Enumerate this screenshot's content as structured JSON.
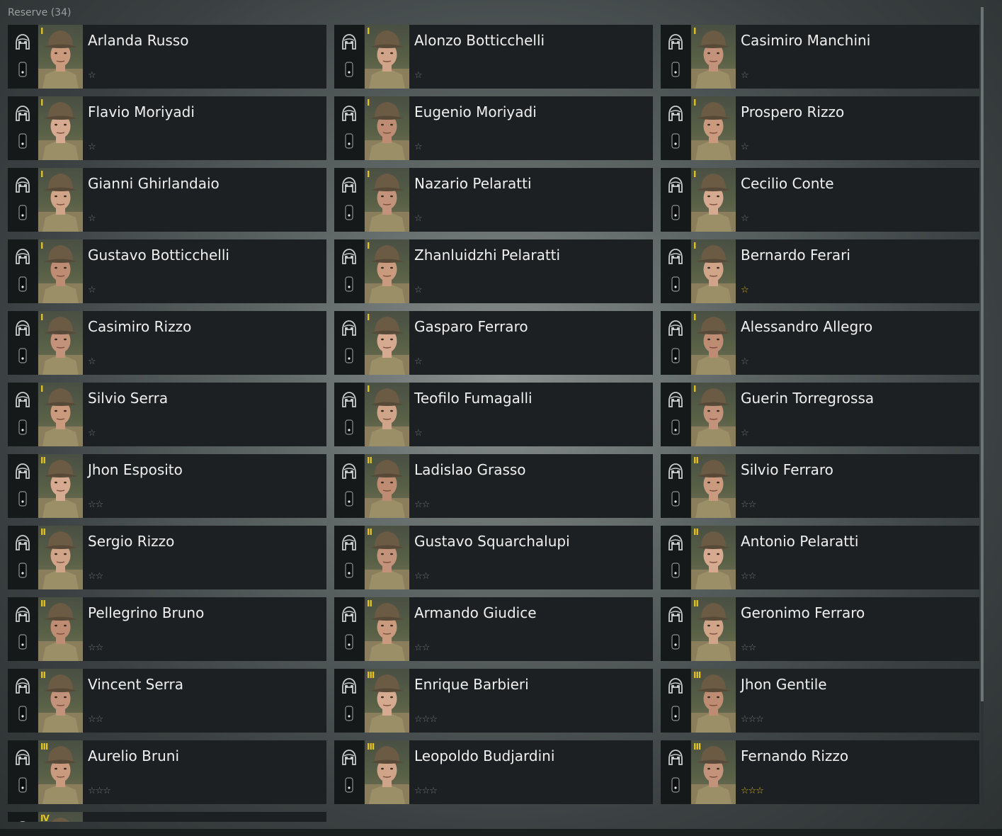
{
  "panel": {
    "title": "Reserve (34)"
  },
  "soldiers": [
    {
      "name": "Arlanda Russo",
      "tier": "I",
      "stars": 1,
      "gold": false
    },
    {
      "name": "Alonzo Botticchelli",
      "tier": "I",
      "stars": 1,
      "gold": false
    },
    {
      "name": "Casimiro Manchini",
      "tier": "I",
      "stars": 1,
      "gold": false
    },
    {
      "name": "Flavio Moriyadi",
      "tier": "I",
      "stars": 1,
      "gold": false
    },
    {
      "name": "Eugenio Moriyadi",
      "tier": "I",
      "stars": 1,
      "gold": false
    },
    {
      "name": "Prospero Rizzo",
      "tier": "I",
      "stars": 1,
      "gold": false
    },
    {
      "name": "Gianni Ghirlandaio",
      "tier": "I",
      "stars": 1,
      "gold": false
    },
    {
      "name": "Nazario Pelaratti",
      "tier": "I",
      "stars": 1,
      "gold": false
    },
    {
      "name": "Cecilio Conte",
      "tier": "I",
      "stars": 1,
      "gold": false
    },
    {
      "name": "Gustavo Botticchelli",
      "tier": "I",
      "stars": 1,
      "gold": false
    },
    {
      "name": "Zhanluidzhi Pelaratti",
      "tier": "I",
      "stars": 1,
      "gold": false
    },
    {
      "name": "Bernardo Ferari",
      "tier": "I",
      "stars": 1,
      "gold": true
    },
    {
      "name": "Casimiro Rizzo",
      "tier": "I",
      "stars": 1,
      "gold": false
    },
    {
      "name": "Gasparo Ferraro",
      "tier": "I",
      "stars": 1,
      "gold": false
    },
    {
      "name": "Alessandro Allegro",
      "tier": "I",
      "stars": 1,
      "gold": false
    },
    {
      "name": "Silvio Serra",
      "tier": "I",
      "stars": 1,
      "gold": false
    },
    {
      "name": "Teofilo Fumagalli",
      "tier": "I",
      "stars": 1,
      "gold": false
    },
    {
      "name": "Guerin Torregrossa",
      "tier": "I",
      "stars": 1,
      "gold": false
    },
    {
      "name": "Jhon Esposito",
      "tier": "II",
      "stars": 2,
      "gold": false
    },
    {
      "name": "Ladislao Grasso",
      "tier": "II",
      "stars": 2,
      "gold": false
    },
    {
      "name": "Silvio Ferraro",
      "tier": "II",
      "stars": 2,
      "gold": false
    },
    {
      "name": "Sergio Rizzo",
      "tier": "II",
      "stars": 2,
      "gold": false
    },
    {
      "name": "Gustavo Squarchalupi",
      "tier": "II",
      "stars": 2,
      "gold": false
    },
    {
      "name": "Antonio Pelaratti",
      "tier": "II",
      "stars": 2,
      "gold": false
    },
    {
      "name": "Pellegrino Bruno",
      "tier": "II",
      "stars": 2,
      "gold": false
    },
    {
      "name": "Armando Giudice",
      "tier": "II",
      "stars": 2,
      "gold": false
    },
    {
      "name": "Geronimo Ferraro",
      "tier": "II",
      "stars": 2,
      "gold": false
    },
    {
      "name": "Vincent Serra",
      "tier": "II",
      "stars": 2,
      "gold": false
    },
    {
      "name": "Enrique Barbieri",
      "tier": "III",
      "stars": 3,
      "gold": false
    },
    {
      "name": "Jhon Gentile",
      "tier": "III",
      "stars": 3,
      "gold": false
    },
    {
      "name": "Aurelio Bruni",
      "tier": "III",
      "stars": 3,
      "gold": false
    },
    {
      "name": "Leopoldo Budjardini",
      "tier": "III",
      "stars": 3,
      "gold": false
    },
    {
      "name": "Fernando Rizzo",
      "tier": "III",
      "stars": 3,
      "gold": true
    },
    {
      "name": "",
      "tier": "IV",
      "stars": 0,
      "gold": false
    }
  ],
  "icons": {
    "class": "pilot-helmet-icon",
    "rank": "rank-insignia-icon",
    "star": "star-icon"
  },
  "colors": {
    "tier": "#e6c422",
    "star_gold": "#d9b51e",
    "star_grey": "#6f7575",
    "card_bg": "#1c2022"
  }
}
